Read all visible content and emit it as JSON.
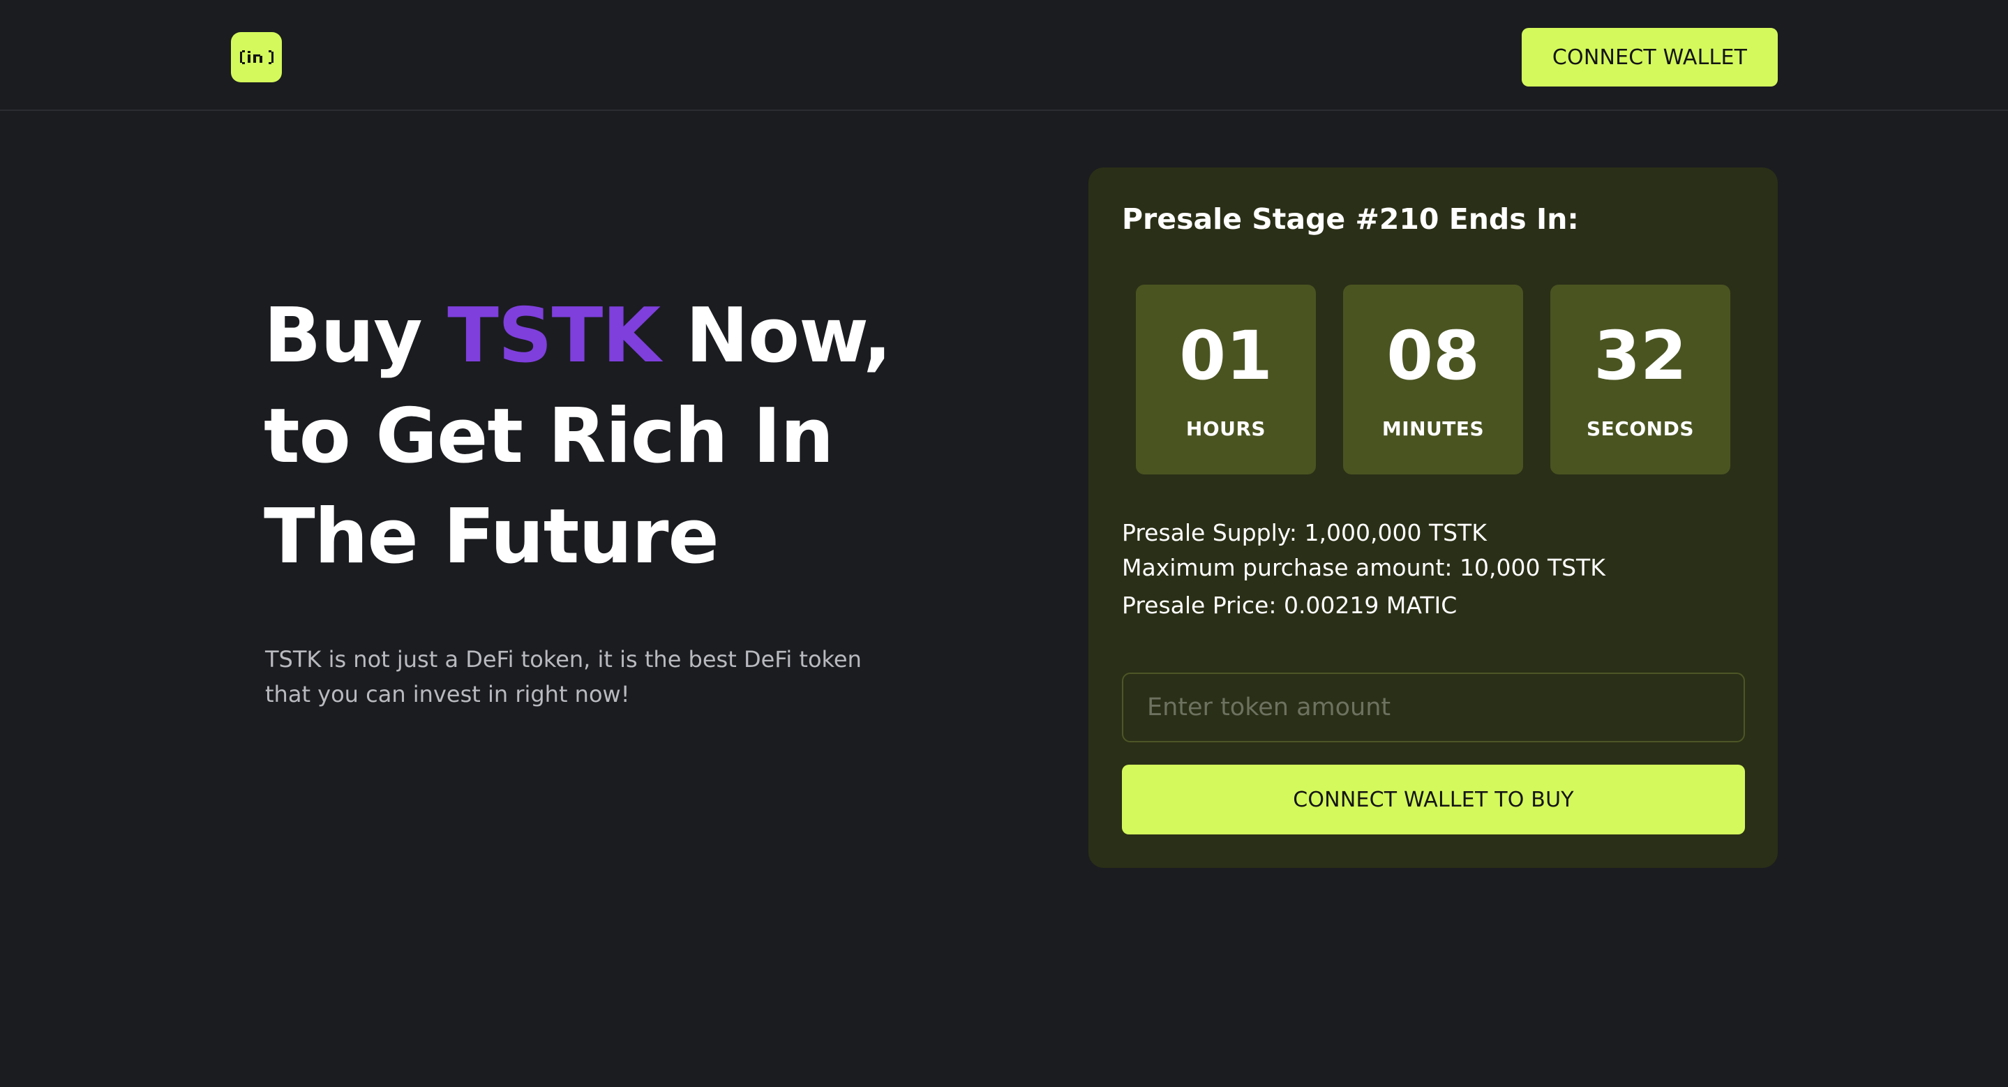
{
  "header": {
    "logo_icon": "in-logo-icon",
    "connect_label": "CONNECT WALLET"
  },
  "hero": {
    "title_before": "Buy ",
    "title_accent": "TSTK",
    "title_after_line1": " Now,",
    "title_line2": "to Get Rich In",
    "title_line3": "The Future",
    "subtitle": "TSTK is not just a DeFi token, it is the best DeFi token that you can invest in right now!"
  },
  "presale": {
    "title": "Presale Stage #210 Ends In:",
    "countdown": [
      {
        "value": "01",
        "label": "HOURS"
      },
      {
        "value": "08",
        "label": "MINUTES"
      },
      {
        "value": "32",
        "label": "SECONDS"
      }
    ],
    "supply": "Presale Supply: 1,000,000 TSTK",
    "max_purchase": "Maximum purchase amount: 10,000 TSTK",
    "price": "Presale Price: 0.00219 MATIC",
    "input_placeholder": "Enter token amount",
    "buy_label": "CONNECT WALLET TO BUY"
  },
  "colors": {
    "background": "#1b1c20",
    "accent_lime": "#d4f95c",
    "accent_purple": "#7e3fdd",
    "card_bg": "#2a2f17",
    "timer_box": "#4a5421"
  }
}
